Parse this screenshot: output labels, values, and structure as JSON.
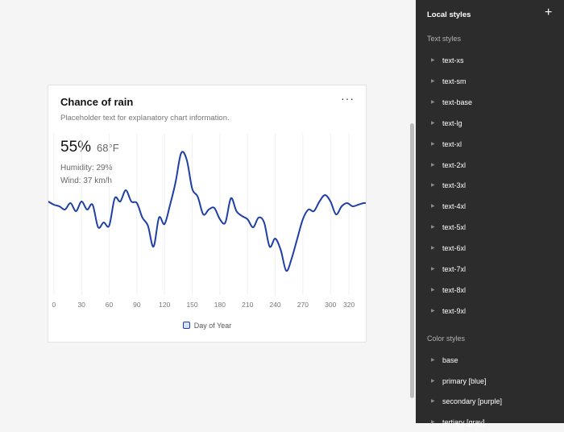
{
  "card": {
    "title": "Chance of rain",
    "menu_glyph": "···",
    "subtitle": "Placeholder text for explanatory chart information.",
    "metric_primary": "55%",
    "metric_secondary": "68°F",
    "humidity": "Humidity: 29%",
    "wind": "Wind: 37 km/h"
  },
  "chart_data": {
    "type": "line",
    "xlabel": "Day of Year",
    "ylabel": "",
    "xlim": [
      -6,
      340
    ],
    "ylim": [
      0,
      100
    ],
    "grid": "vertical",
    "xticks": [
      0,
      30,
      60,
      90,
      120,
      150,
      180,
      210,
      240,
      270,
      300,
      320
    ],
    "legend": "bottom-center",
    "color": "#1e3fa5",
    "series": [
      {
        "name": "Day of Year",
        "x": [
          -6,
          0,
          6,
          12,
          18,
          24,
          30,
          36,
          42,
          48,
          54,
          60,
          66,
          72,
          78,
          84,
          90,
          96,
          102,
          108,
          114,
          120,
          126,
          132,
          138,
          144,
          150,
          156,
          162,
          168,
          174,
          180,
          186,
          192,
          198,
          204,
          210,
          216,
          222,
          228,
          234,
          240,
          246,
          252,
          258,
          264,
          270,
          276,
          282,
          288,
          294,
          300,
          306,
          312,
          318,
          324,
          330,
          336,
          340
        ],
        "y": [
          58,
          56,
          55,
          53,
          57,
          52,
          58,
          53,
          56,
          42,
          45,
          43,
          60,
          58,
          65,
          58,
          57,
          48,
          43,
          30,
          48,
          44,
          56,
          70,
          88,
          84,
          66,
          61,
          50,
          53,
          54,
          47,
          45,
          60,
          52,
          49,
          47,
          42,
          48,
          45,
          30,
          35,
          28,
          15,
          23,
          35,
          47,
          53,
          52,
          58,
          62,
          58,
          50,
          55,
          57,
          55,
          56,
          57,
          57
        ]
      }
    ]
  },
  "panel": {
    "title": "Local styles",
    "add_glyph": "+",
    "text_styles_heading": "Text styles",
    "text_styles": [
      "text-xs",
      "text-sm",
      "text-base",
      "text-lg",
      "text-xl",
      "text-2xl",
      "text-3xl",
      "text-4xl",
      "text-5xl",
      "text-6xl",
      "text-7xl",
      "text-8xl",
      "text-9xl"
    ],
    "color_styles_heading": "Color styles",
    "color_styles": [
      "base",
      "primary [blue]",
      "secondary [purple]",
      "tertiary [gray]"
    ]
  }
}
